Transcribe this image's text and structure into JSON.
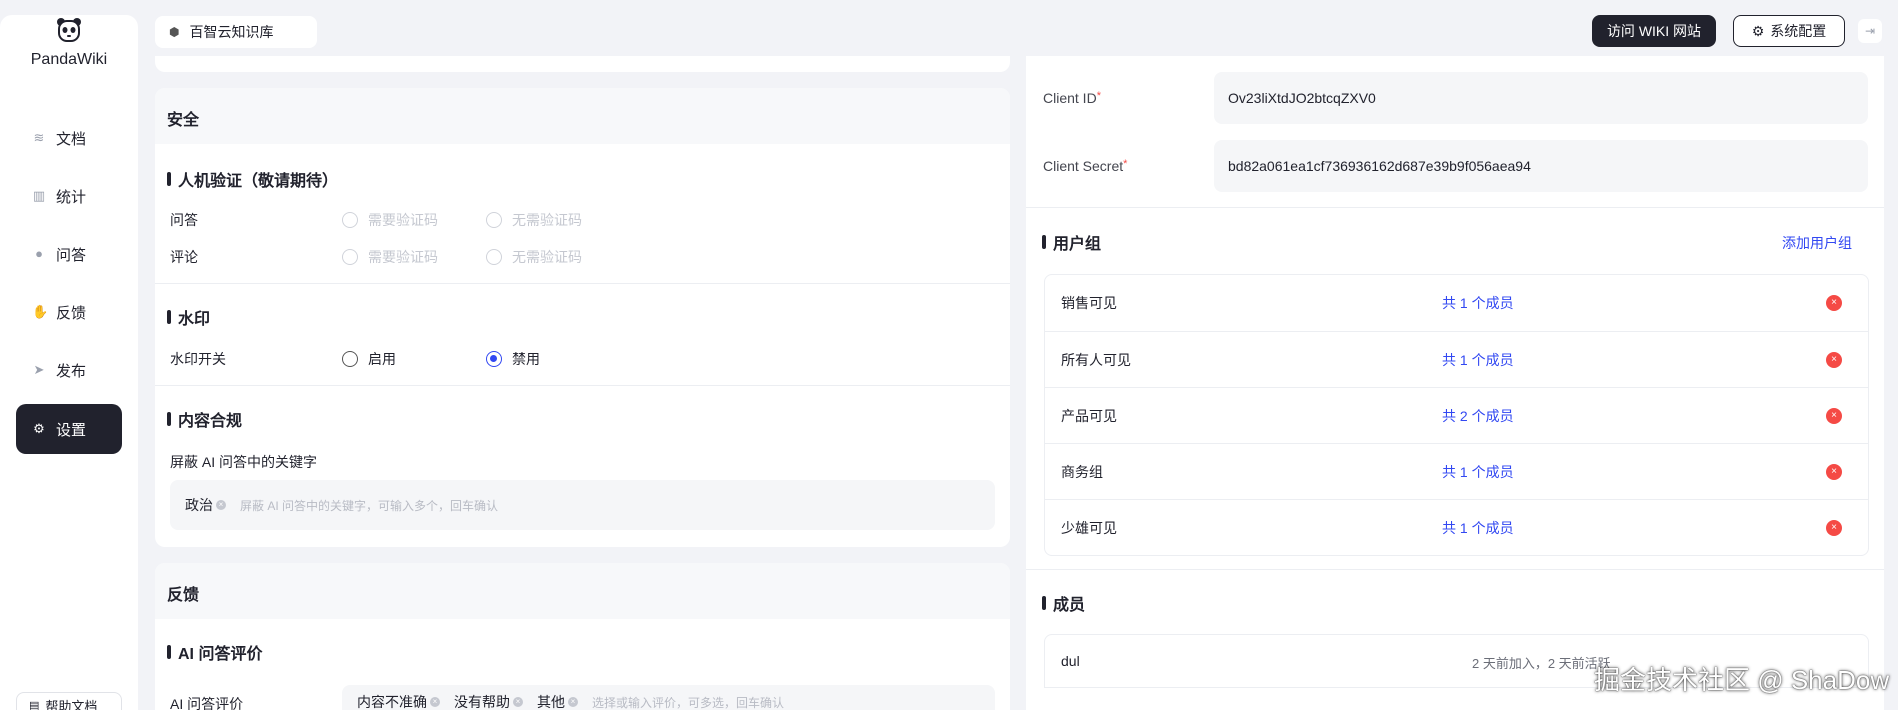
{
  "app": {
    "name": "PandaWiki",
    "logo_icon": "panda-icon"
  },
  "sidebar": {
    "items": [
      {
        "label": "文档",
        "icon": "layers-icon"
      },
      {
        "label": "统计",
        "icon": "bar-chart-icon"
      },
      {
        "label": "问答",
        "icon": "chat-bubble-icon"
      },
      {
        "label": "反馈",
        "icon": "thumb-icon"
      },
      {
        "label": "发布",
        "icon": "send-icon"
      },
      {
        "label": "设置",
        "icon": "gear-icon",
        "active": true
      }
    ],
    "help_label": "帮助文档"
  },
  "header": {
    "kb_name": "百智云知识库",
    "visit_button": "访问 WIKI 网站",
    "config_button": "系统配置"
  },
  "security": {
    "title": "安全",
    "captcha": {
      "title": "人机验证（敬请期待）",
      "rows": [
        {
          "label": "问答",
          "opt1": "需要验证码",
          "opt2": "无需验证码"
        },
        {
          "label": "评论",
          "opt1": "需要验证码",
          "opt2": "无需验证码"
        }
      ]
    },
    "watermark": {
      "title": "水印",
      "label": "水印开关",
      "opt_enable": "启用",
      "opt_disable": "禁用",
      "selected": "禁用"
    },
    "compliance": {
      "title": "内容合规",
      "label": "屏蔽 AI 问答中的关键字",
      "tags": [
        "政治"
      ],
      "placeholder": "屏蔽 AI 问答中的关键字，可输入多个，回车确认"
    }
  },
  "feedback": {
    "title": "反馈",
    "ai_rating": {
      "title": "AI 问答评价",
      "label": "AI 问答评价",
      "tags": [
        "内容不准确",
        "没有帮助",
        "其他"
      ],
      "placeholder": "选择或输入评价，可多选，回车确认"
    }
  },
  "auth": {
    "client_id_label": "Client ID",
    "client_id_value": "Ov23liXtdJO2btcqZXV0",
    "client_secret_label": "Client Secret",
    "client_secret_value": "bd82a061ea1cf736936162d687e39b9f056aea94",
    "required_mark": "*"
  },
  "user_groups": {
    "title": "用户组",
    "add_label": "添加用户组",
    "groups": [
      {
        "name": "销售可见",
        "count": "共 1 个成员"
      },
      {
        "name": "所有人可见",
        "count": "共 1 个成员"
      },
      {
        "name": "产品可见",
        "count": "共 2 个成员"
      },
      {
        "name": "商务组",
        "count": "共 1 个成员"
      },
      {
        "name": "少雄可见",
        "count": "共 1 个成员"
      }
    ]
  },
  "members": {
    "title": "成员",
    "rows": [
      {
        "name": "dul",
        "activity": "2 天前加入，2 天前活跃"
      }
    ]
  },
  "overlay_watermark": "掘金技术社区 @ ShaDow",
  "colors": {
    "accent": "#3248f2",
    "dark": "#21222d",
    "danger": "#f54a45"
  }
}
